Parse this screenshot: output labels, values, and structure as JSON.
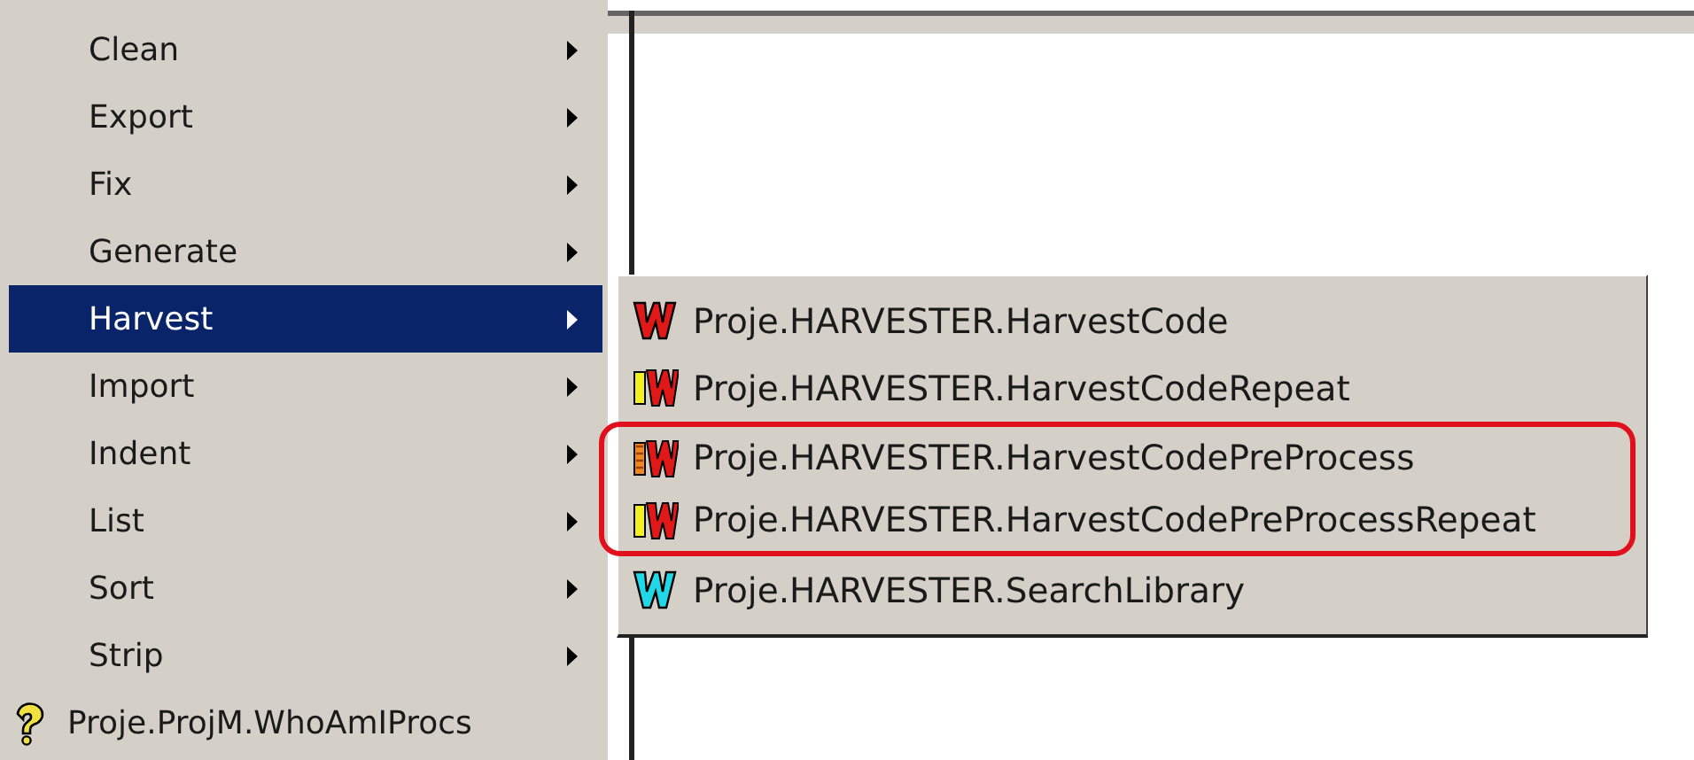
{
  "menu": {
    "items": [
      {
        "label": "Clean",
        "kind": "submenu",
        "selected": false
      },
      {
        "label": "Export",
        "kind": "submenu",
        "selected": false
      },
      {
        "label": "Fix",
        "kind": "submenu",
        "selected": false
      },
      {
        "label": "Generate",
        "kind": "submenu",
        "selected": false
      },
      {
        "label": "Harvest",
        "kind": "submenu",
        "selected": true
      },
      {
        "label": "Import",
        "kind": "submenu",
        "selected": false
      },
      {
        "label": "Indent",
        "kind": "submenu",
        "selected": false
      },
      {
        "label": "List",
        "kind": "submenu",
        "selected": false
      },
      {
        "label": "Sort",
        "kind": "submenu",
        "selected": false
      },
      {
        "label": "Strip",
        "kind": "submenu",
        "selected": false
      },
      {
        "label": "Proje.ProjM.WhoAmIProcs",
        "kind": "command",
        "selected": false
      }
    ]
  },
  "submenu": {
    "items": [
      {
        "label": "Proje.HARVESTER.HarvestCode",
        "kind": "code",
        "circled": false
      },
      {
        "label": "Proje.HARVESTER.HarvestCodeRepeat",
        "kind": "repeat",
        "circled": false
      },
      {
        "label": "Proje.HARVESTER.HarvestCodePreProcess",
        "kind": "preprocess",
        "circled": true
      },
      {
        "label": "Proje.HARVESTER.HarvestCodePreProcessRepeat",
        "kind": "repeat",
        "circled": true
      },
      {
        "label": "Proje.HARVESTER.SearchLibrary",
        "kind": "search",
        "circled": false
      }
    ]
  }
}
